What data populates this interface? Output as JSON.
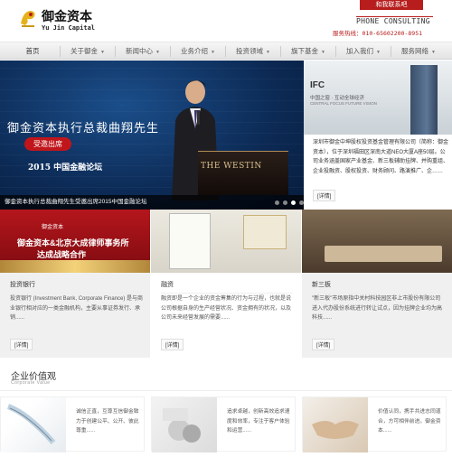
{
  "header": {
    "logo_title": "御金资本",
    "logo_sub": "Yu Jin Capital",
    "contact_button": "和我联系吧",
    "phone_title": "PHONE CONSULTING",
    "phone_number": "服务热线：010-65602200-8951"
  },
  "nav": {
    "items": [
      {
        "label": "首页",
        "has_arrow": false
      },
      {
        "label": "关于御金",
        "has_arrow": true
      },
      {
        "label": "新闻中心",
        "has_arrow": true
      },
      {
        "label": "业务介绍",
        "has_arrow": true
      },
      {
        "label": "投资领域",
        "has_arrow": true
      },
      {
        "label": "旗下基金",
        "has_arrow": true
      },
      {
        "label": "加入我们",
        "has_arrow": true
      },
      {
        "label": "服务网络",
        "has_arrow": true
      }
    ],
    "arrow": "▼"
  },
  "hero": {
    "title": "御金资本执行总裁曲翔先生",
    "pill": "受邀出席",
    "forum": "2015 中国金融论坛",
    "caption": "御金资本执行总裁曲翔先生受邀出席2015中国金融论坛",
    "sign": "THE WESTIN",
    "dots": 4,
    "active_dot": 2
  },
  "side": {
    "ifc_logo": "IFC",
    "ifc_line1": "中国之窗 · 互动全球经济",
    "ifc_line2": "CENTRAL FOCUS FUTURE VISION",
    "text": "深圳市御金中坤股权投资基金管理有限公司（简称：御金资本），位于深圳福田区深南大道NEO大厦A座50层。公司业务涵盖国家产业基金、新三板辅助挂牌、并购重组、企业投融资、股权投资、财务顾问、路演推广、企……",
    "more": "[详情]"
  },
  "cards": [
    {
      "title": "投资银行",
      "text": "投资银行 (Investment Bank, Corporate Finance) 是与商业银行相对应的一类金融机构，主要从事证券发行、承销......",
      "more": "[详情]",
      "img_brand": "御金资本",
      "img_line1": "御金资本&北京大成律师事务所",
      "img_line2": "达成战略合作"
    },
    {
      "title": "融资",
      "text": "融资即是一个企业的资金筹集的行为与过程，也就是说公司根据自身的生产经营状况、资金拥有的状况，以及公司未来经营发展的需要......",
      "more": "[详情]"
    },
    {
      "title": "新三板",
      "text": "\"新三板\"市场原指中关村科技园区非上市股份有限公司进入代办股份系统进行转让试点，因为挂牌企业均为高科技......",
      "more": "[详情]"
    }
  ],
  "values_section": {
    "title": "企业价值观",
    "subtitle": "Corporate Value",
    "items": [
      {
        "text": "诚信正直，互尊互信御金致力于创建公平、公开、彼此尊重......"
      },
      {
        "text": "追求卓越，创新高效追求速度和效率，专注于客户体验和运营......"
      },
      {
        "text": "价值认同，携手共进志同道合，方可相伴前进。御金资本......"
      }
    ]
  },
  "colors": {
    "brand_red": "#b71d1d",
    "hero_blue": "#0c2a55"
  }
}
